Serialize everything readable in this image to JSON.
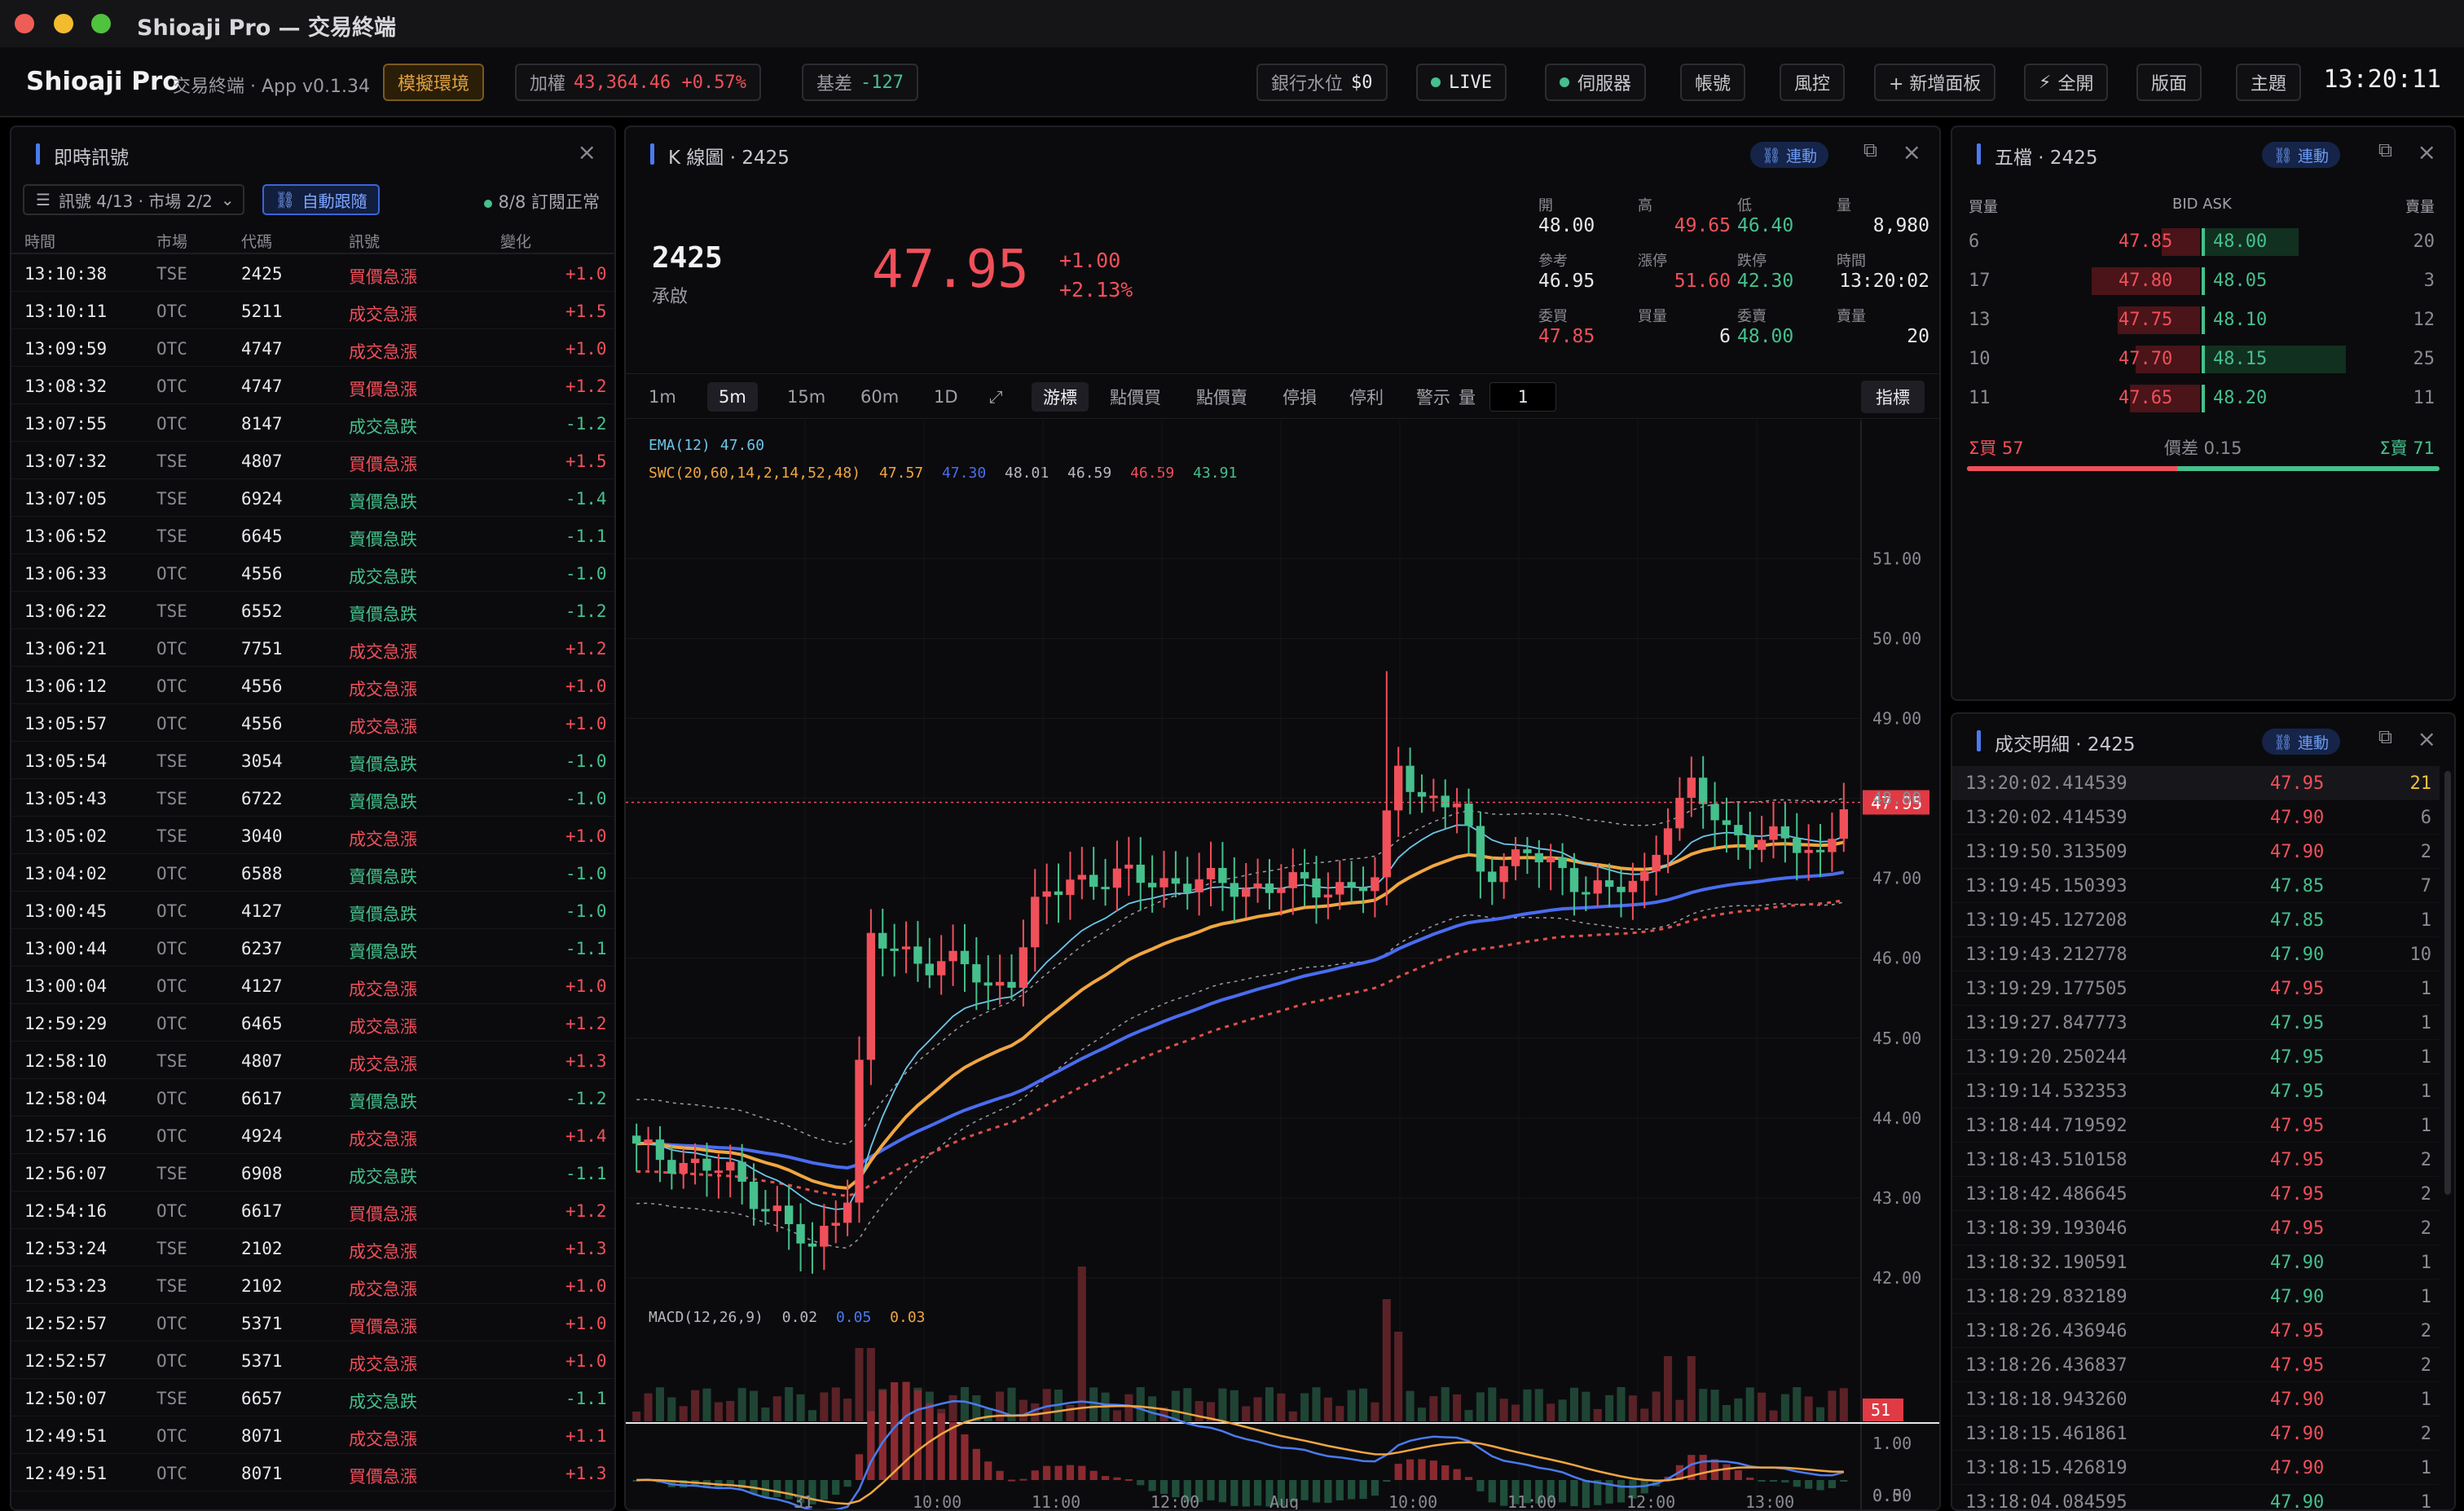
{
  "window": {
    "title": "Shioaji Pro — 交易終端"
  },
  "header": {
    "brand": "Shioaji Pro",
    "subtitle": "交易終端 · App v0.1.34",
    "env_badge": "模擬環境",
    "index_label": "加權",
    "index_value": "43,364.46 +0.57%",
    "basis_label": "基差",
    "basis_value": "-127",
    "bank_label": "銀行水位",
    "bank_value": "$0",
    "live": "LIVE",
    "server": "伺服器",
    "account": "帳號",
    "risk": "風控",
    "add_panel": "+ 新增面板",
    "fullscreen": "全開",
    "layout": "版面",
    "theme": "主題",
    "clock": "13:20:11",
    "colors": {
      "accent": "#4a7bf0",
      "up": "#f0505a",
      "down": "#46c08c",
      "env": "#e0a040"
    }
  },
  "signals": {
    "title": "即時訊號",
    "filter": "訊號 4/13 · 市場 2/2",
    "follow": "自動跟隨",
    "subscription": "8/8 訂閱正常",
    "columns": [
      "時間",
      "市場",
      "代碼",
      "訊號",
      "變化"
    ],
    "rows": [
      [
        "13:10:38",
        "TSE",
        "2425",
        "買價急漲",
        "+1.0",
        "up"
      ],
      [
        "13:10:11",
        "OTC",
        "5211",
        "成交急漲",
        "+1.5",
        "up"
      ],
      [
        "13:09:59",
        "OTC",
        "4747",
        "成交急漲",
        "+1.0",
        "up"
      ],
      [
        "13:08:32",
        "OTC",
        "4747",
        "買價急漲",
        "+1.2",
        "up"
      ],
      [
        "13:07:55",
        "OTC",
        "8147",
        "成交急跌",
        "-1.2",
        "down"
      ],
      [
        "13:07:32",
        "TSE",
        "4807",
        "買價急漲",
        "+1.5",
        "up"
      ],
      [
        "13:07:05",
        "TSE",
        "6924",
        "賣價急跌",
        "-1.4",
        "down"
      ],
      [
        "13:06:52",
        "TSE",
        "6645",
        "賣價急跌",
        "-1.1",
        "down"
      ],
      [
        "13:06:33",
        "OTC",
        "4556",
        "成交急跌",
        "-1.0",
        "down"
      ],
      [
        "13:06:22",
        "TSE",
        "6552",
        "賣價急跌",
        "-1.2",
        "down"
      ],
      [
        "13:06:21",
        "OTC",
        "7751",
        "成交急漲",
        "+1.2",
        "up"
      ],
      [
        "13:06:12",
        "OTC",
        "4556",
        "成交急漲",
        "+1.0",
        "up"
      ],
      [
        "13:05:57",
        "OTC",
        "4556",
        "成交急漲",
        "+1.0",
        "up"
      ],
      [
        "13:05:54",
        "TSE",
        "3054",
        "賣價急跌",
        "-1.0",
        "down"
      ],
      [
        "13:05:43",
        "TSE",
        "6722",
        "賣價急跌",
        "-1.0",
        "down"
      ],
      [
        "13:05:02",
        "TSE",
        "3040",
        "成交急漲",
        "+1.0",
        "up"
      ],
      [
        "13:04:02",
        "OTC",
        "6588",
        "賣價急跌",
        "-1.0",
        "down"
      ],
      [
        "13:00:45",
        "OTC",
        "4127",
        "賣價急跌",
        "-1.0",
        "down"
      ],
      [
        "13:00:44",
        "OTC",
        "6237",
        "賣價急跌",
        "-1.1",
        "down"
      ],
      [
        "13:00:04",
        "OTC",
        "4127",
        "成交急漲",
        "+1.0",
        "up"
      ],
      [
        "12:59:29",
        "OTC",
        "6465",
        "成交急漲",
        "+1.2",
        "up"
      ],
      [
        "12:58:10",
        "TSE",
        "4807",
        "成交急漲",
        "+1.3",
        "up"
      ],
      [
        "12:58:04",
        "OTC",
        "6617",
        "賣價急跌",
        "-1.2",
        "down"
      ],
      [
        "12:57:16",
        "OTC",
        "4924",
        "成交急漲",
        "+1.4",
        "up"
      ],
      [
        "12:56:07",
        "TSE",
        "6908",
        "成交急跌",
        "-1.1",
        "down"
      ],
      [
        "12:54:16",
        "OTC",
        "6617",
        "買價急漲",
        "+1.2",
        "up"
      ],
      [
        "12:53:24",
        "TSE",
        "2102",
        "成交急漲",
        "+1.3",
        "up"
      ],
      [
        "12:53:23",
        "TSE",
        "2102",
        "成交急漲",
        "+1.0",
        "up"
      ],
      [
        "12:52:57",
        "OTC",
        "5371",
        "買價急漲",
        "+1.0",
        "up"
      ],
      [
        "12:52:57",
        "OTC",
        "5371",
        "成交急漲",
        "+1.0",
        "up"
      ],
      [
        "12:50:07",
        "TSE",
        "6657",
        "成交急跌",
        "-1.1",
        "down"
      ],
      [
        "12:49:51",
        "OTC",
        "8071",
        "成交急漲",
        "+1.1",
        "up"
      ],
      [
        "12:49:51",
        "OTC",
        "8071",
        "買價急漲",
        "+1.3",
        "up"
      ]
    ]
  },
  "kchart": {
    "title": "K 線圖 · 2425",
    "link": "連動",
    "symbol": "2425",
    "name": "承啟",
    "price": "47.95",
    "change": "+1.00",
    "change_pct": "+2.13%",
    "stats": [
      {
        "label": "開",
        "value": "48.00",
        "tone": "white"
      },
      {
        "label": "高",
        "value": "49.65",
        "tone": "red"
      },
      {
        "label": "低",
        "value": "46.40",
        "tone": "green"
      },
      {
        "label": "量",
        "value": "8,980",
        "tone": "white"
      },
      {
        "label": "參考",
        "value": "46.95",
        "tone": "white"
      },
      {
        "label": "漲停",
        "value": "51.60",
        "tone": "red"
      },
      {
        "label": "跌停",
        "value": "42.30",
        "tone": "green"
      },
      {
        "label": "時間",
        "value": "13:20:02",
        "tone": "white"
      },
      {
        "label": "委買",
        "value": "47.85",
        "tone": "red"
      },
      {
        "label": "買量",
        "value": "6",
        "tone": "white"
      },
      {
        "label": "委賣",
        "value": "48.00",
        "tone": "green"
      },
      {
        "label": "賣量",
        "value": "20",
        "tone": "white"
      }
    ],
    "intervals": [
      "1m",
      "5m",
      "15m",
      "60m",
      "1D"
    ],
    "active_interval": "5m",
    "tools": [
      "游標",
      "點價買",
      "點價賣",
      "停損",
      "停利",
      "警示"
    ],
    "qty_label": "量",
    "qty_value": "1",
    "indicator_button": "指標",
    "ema_label": "EMA(12)",
    "ema_value": "47.60",
    "swc_label": "SWC(20,60,14,2,14,52,48)",
    "swc_values": [
      "47.57",
      "47.30",
      "48.01",
      "46.59",
      "46.59",
      "43.91"
    ],
    "macd_label": "MACD(12,26,9)",
    "macd_values": [
      "0.02",
      "0.05",
      "0.03"
    ]
  },
  "chart_data": {
    "type": "candlestick",
    "price_axis": [
      "51.00",
      "50.00",
      "49.00",
      "48.00",
      "47.00",
      "46.00",
      "45.00",
      "44.00",
      "43.00",
      "42.00"
    ],
    "ylim": [
      41.0,
      51.3
    ],
    "last_price_tag": "47.95",
    "volume_tag": "51",
    "macd_axis": [
      "1.00",
      "0.50",
      "0.00"
    ],
    "time_axis": [
      "31",
      "10:00",
      "11:00",
      "12:00",
      "Aug",
      "10:00",
      "11:00",
      "12:00",
      "13:00"
    ],
    "bars": 104,
    "key_points": [
      {
        "i": 0,
        "close": 43.6
      },
      {
        "i": 8,
        "close": 43.3
      },
      {
        "i": 12,
        "close": 42.8
      },
      {
        "i": 15,
        "close": 42.3
      },
      {
        "i": 18,
        "close": 43.1
      },
      {
        "i": 20,
        "close": 46.2
      },
      {
        "i": 24,
        "close": 46.0
      },
      {
        "i": 28,
        "close": 45.9
      },
      {
        "i": 30,
        "close": 45.6
      },
      {
        "i": 32,
        "close": 45.8
      },
      {
        "i": 34,
        "close": 46.6
      },
      {
        "i": 37,
        "close": 47.0
      },
      {
        "i": 42,
        "close": 47.0
      },
      {
        "i": 52,
        "close": 46.9
      },
      {
        "i": 63,
        "close": 46.9
      },
      {
        "i": 65,
        "close": 48.5
      },
      {
        "i": 67,
        "close": 48.0
      },
      {
        "i": 70,
        "close": 47.9
      },
      {
        "i": 72,
        "close": 47.1
      },
      {
        "i": 76,
        "close": 47.3
      },
      {
        "i": 80,
        "close": 47.0
      },
      {
        "i": 83,
        "close": 46.8
      },
      {
        "i": 86,
        "close": 47.0
      },
      {
        "i": 88,
        "close": 47.8
      },
      {
        "i": 90,
        "close": 48.1
      },
      {
        "i": 93,
        "close": 47.6
      },
      {
        "i": 96,
        "close": 47.5
      },
      {
        "i": 99,
        "close": 47.4
      },
      {
        "i": 101,
        "close": 47.3
      },
      {
        "i": 103,
        "close": 47.95
      }
    ]
  },
  "orderbook": {
    "title": "五檔 · 2425",
    "link": "連動",
    "head_bid": "買量",
    "head_mid": "BID ASK",
    "head_ask": "賣量",
    "rows": [
      {
        "bid_qty": "6",
        "bid": "47.85",
        "ask": "48.00",
        "ask_qty": "20",
        "bid_w": 0.26,
        "ask_w": 0.64
      },
      {
        "bid_qty": "17",
        "bid": "47.80",
        "ask": "48.05",
        "ask_qty": "3",
        "bid_w": 0.74,
        "ask_w": 0.0
      },
      {
        "bid_qty": "13",
        "bid": "47.75",
        "ask": "48.10",
        "ask_qty": "12",
        "bid_w": 0.56,
        "ask_w": 0.0
      },
      {
        "bid_qty": "10",
        "bid": "47.70",
        "ask": "48.15",
        "ask_qty": "25",
        "bid_w": 0.44,
        "ask_w": 0.96
      },
      {
        "bid_qty": "11",
        "bid": "47.65",
        "ask": "48.20",
        "ask_qty": "11",
        "bid_w": 0.48,
        "ask_w": 0.0
      }
    ],
    "sum_bid": "Σ買 57",
    "spread": "價差 0.15",
    "sum_ask": "Σ賣 71",
    "bid_ratio": 0.445
  },
  "trades": {
    "title": "成交明細 · 2425",
    "link": "連動",
    "rows": [
      [
        "13:20:02.414539",
        "47.95",
        "21",
        "up"
      ],
      [
        "13:20:02.414539",
        "47.90",
        "6",
        "up"
      ],
      [
        "13:19:50.313509",
        "47.90",
        "2",
        "up"
      ],
      [
        "13:19:45.150393",
        "47.85",
        "7",
        "down"
      ],
      [
        "13:19:45.127208",
        "47.85",
        "1",
        "down"
      ],
      [
        "13:19:43.212778",
        "47.90",
        "10",
        "down"
      ],
      [
        "13:19:29.177505",
        "47.95",
        "1",
        "up"
      ],
      [
        "13:19:27.847773",
        "47.95",
        "1",
        "down"
      ],
      [
        "13:19:20.250244",
        "47.95",
        "1",
        "down"
      ],
      [
        "13:19:14.532353",
        "47.95",
        "1",
        "down"
      ],
      [
        "13:18:44.719592",
        "47.95",
        "1",
        "up"
      ],
      [
        "13:18:43.510158",
        "47.95",
        "2",
        "up"
      ],
      [
        "13:18:42.486645",
        "47.95",
        "2",
        "up"
      ],
      [
        "13:18:39.193046",
        "47.95",
        "2",
        "up"
      ],
      [
        "13:18:32.190591",
        "47.90",
        "1",
        "down"
      ],
      [
        "13:18:29.832189",
        "47.90",
        "1",
        "down"
      ],
      [
        "13:18:26.436946",
        "47.95",
        "2",
        "up"
      ],
      [
        "13:18:26.436837",
        "47.95",
        "2",
        "up"
      ],
      [
        "13:18:18.943260",
        "47.90",
        "1",
        "up"
      ],
      [
        "13:18:15.461861",
        "47.90",
        "2",
        "up"
      ],
      [
        "13:18:15.426819",
        "47.90",
        "1",
        "up"
      ],
      [
        "13:18:04.084595",
        "47.90",
        "1",
        "down"
      ]
    ]
  }
}
